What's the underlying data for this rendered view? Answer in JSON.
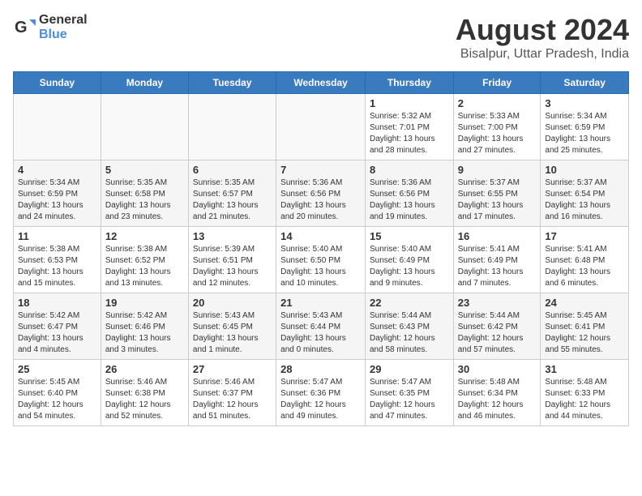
{
  "logo": {
    "text_general": "General",
    "text_blue": "Blue"
  },
  "title": "August 2024",
  "subtitle": "Bisalpur, Uttar Pradesh, India",
  "days_of_week": [
    "Sunday",
    "Monday",
    "Tuesday",
    "Wednesday",
    "Thursday",
    "Friday",
    "Saturday"
  ],
  "weeks": [
    [
      {
        "num": "",
        "info": ""
      },
      {
        "num": "",
        "info": ""
      },
      {
        "num": "",
        "info": ""
      },
      {
        "num": "",
        "info": ""
      },
      {
        "num": "1",
        "info": "Sunrise: 5:32 AM\nSunset: 7:01 PM\nDaylight: 13 hours\nand 28 minutes."
      },
      {
        "num": "2",
        "info": "Sunrise: 5:33 AM\nSunset: 7:00 PM\nDaylight: 13 hours\nand 27 minutes."
      },
      {
        "num": "3",
        "info": "Sunrise: 5:34 AM\nSunset: 6:59 PM\nDaylight: 13 hours\nand 25 minutes."
      }
    ],
    [
      {
        "num": "4",
        "info": "Sunrise: 5:34 AM\nSunset: 6:59 PM\nDaylight: 13 hours\nand 24 minutes."
      },
      {
        "num": "5",
        "info": "Sunrise: 5:35 AM\nSunset: 6:58 PM\nDaylight: 13 hours\nand 23 minutes."
      },
      {
        "num": "6",
        "info": "Sunrise: 5:35 AM\nSunset: 6:57 PM\nDaylight: 13 hours\nand 21 minutes."
      },
      {
        "num": "7",
        "info": "Sunrise: 5:36 AM\nSunset: 6:56 PM\nDaylight: 13 hours\nand 20 minutes."
      },
      {
        "num": "8",
        "info": "Sunrise: 5:36 AM\nSunset: 6:56 PM\nDaylight: 13 hours\nand 19 minutes."
      },
      {
        "num": "9",
        "info": "Sunrise: 5:37 AM\nSunset: 6:55 PM\nDaylight: 13 hours\nand 17 minutes."
      },
      {
        "num": "10",
        "info": "Sunrise: 5:37 AM\nSunset: 6:54 PM\nDaylight: 13 hours\nand 16 minutes."
      }
    ],
    [
      {
        "num": "11",
        "info": "Sunrise: 5:38 AM\nSunset: 6:53 PM\nDaylight: 13 hours\nand 15 minutes."
      },
      {
        "num": "12",
        "info": "Sunrise: 5:38 AM\nSunset: 6:52 PM\nDaylight: 13 hours\nand 13 minutes."
      },
      {
        "num": "13",
        "info": "Sunrise: 5:39 AM\nSunset: 6:51 PM\nDaylight: 13 hours\nand 12 minutes."
      },
      {
        "num": "14",
        "info": "Sunrise: 5:40 AM\nSunset: 6:50 PM\nDaylight: 13 hours\nand 10 minutes."
      },
      {
        "num": "15",
        "info": "Sunrise: 5:40 AM\nSunset: 6:49 PM\nDaylight: 13 hours\nand 9 minutes."
      },
      {
        "num": "16",
        "info": "Sunrise: 5:41 AM\nSunset: 6:49 PM\nDaylight: 13 hours\nand 7 minutes."
      },
      {
        "num": "17",
        "info": "Sunrise: 5:41 AM\nSunset: 6:48 PM\nDaylight: 13 hours\nand 6 minutes."
      }
    ],
    [
      {
        "num": "18",
        "info": "Sunrise: 5:42 AM\nSunset: 6:47 PM\nDaylight: 13 hours\nand 4 minutes."
      },
      {
        "num": "19",
        "info": "Sunrise: 5:42 AM\nSunset: 6:46 PM\nDaylight: 13 hours\nand 3 minutes."
      },
      {
        "num": "20",
        "info": "Sunrise: 5:43 AM\nSunset: 6:45 PM\nDaylight: 13 hours\nand 1 minute."
      },
      {
        "num": "21",
        "info": "Sunrise: 5:43 AM\nSunset: 6:44 PM\nDaylight: 13 hours\nand 0 minutes."
      },
      {
        "num": "22",
        "info": "Sunrise: 5:44 AM\nSunset: 6:43 PM\nDaylight: 12 hours\nand 58 minutes."
      },
      {
        "num": "23",
        "info": "Sunrise: 5:44 AM\nSunset: 6:42 PM\nDaylight: 12 hours\nand 57 minutes."
      },
      {
        "num": "24",
        "info": "Sunrise: 5:45 AM\nSunset: 6:41 PM\nDaylight: 12 hours\nand 55 minutes."
      }
    ],
    [
      {
        "num": "25",
        "info": "Sunrise: 5:45 AM\nSunset: 6:40 PM\nDaylight: 12 hours\nand 54 minutes."
      },
      {
        "num": "26",
        "info": "Sunrise: 5:46 AM\nSunset: 6:38 PM\nDaylight: 12 hours\nand 52 minutes."
      },
      {
        "num": "27",
        "info": "Sunrise: 5:46 AM\nSunset: 6:37 PM\nDaylight: 12 hours\nand 51 minutes."
      },
      {
        "num": "28",
        "info": "Sunrise: 5:47 AM\nSunset: 6:36 PM\nDaylight: 12 hours\nand 49 minutes."
      },
      {
        "num": "29",
        "info": "Sunrise: 5:47 AM\nSunset: 6:35 PM\nDaylight: 12 hours\nand 47 minutes."
      },
      {
        "num": "30",
        "info": "Sunrise: 5:48 AM\nSunset: 6:34 PM\nDaylight: 12 hours\nand 46 minutes."
      },
      {
        "num": "31",
        "info": "Sunrise: 5:48 AM\nSunset: 6:33 PM\nDaylight: 12 hours\nand 44 minutes."
      }
    ]
  ]
}
